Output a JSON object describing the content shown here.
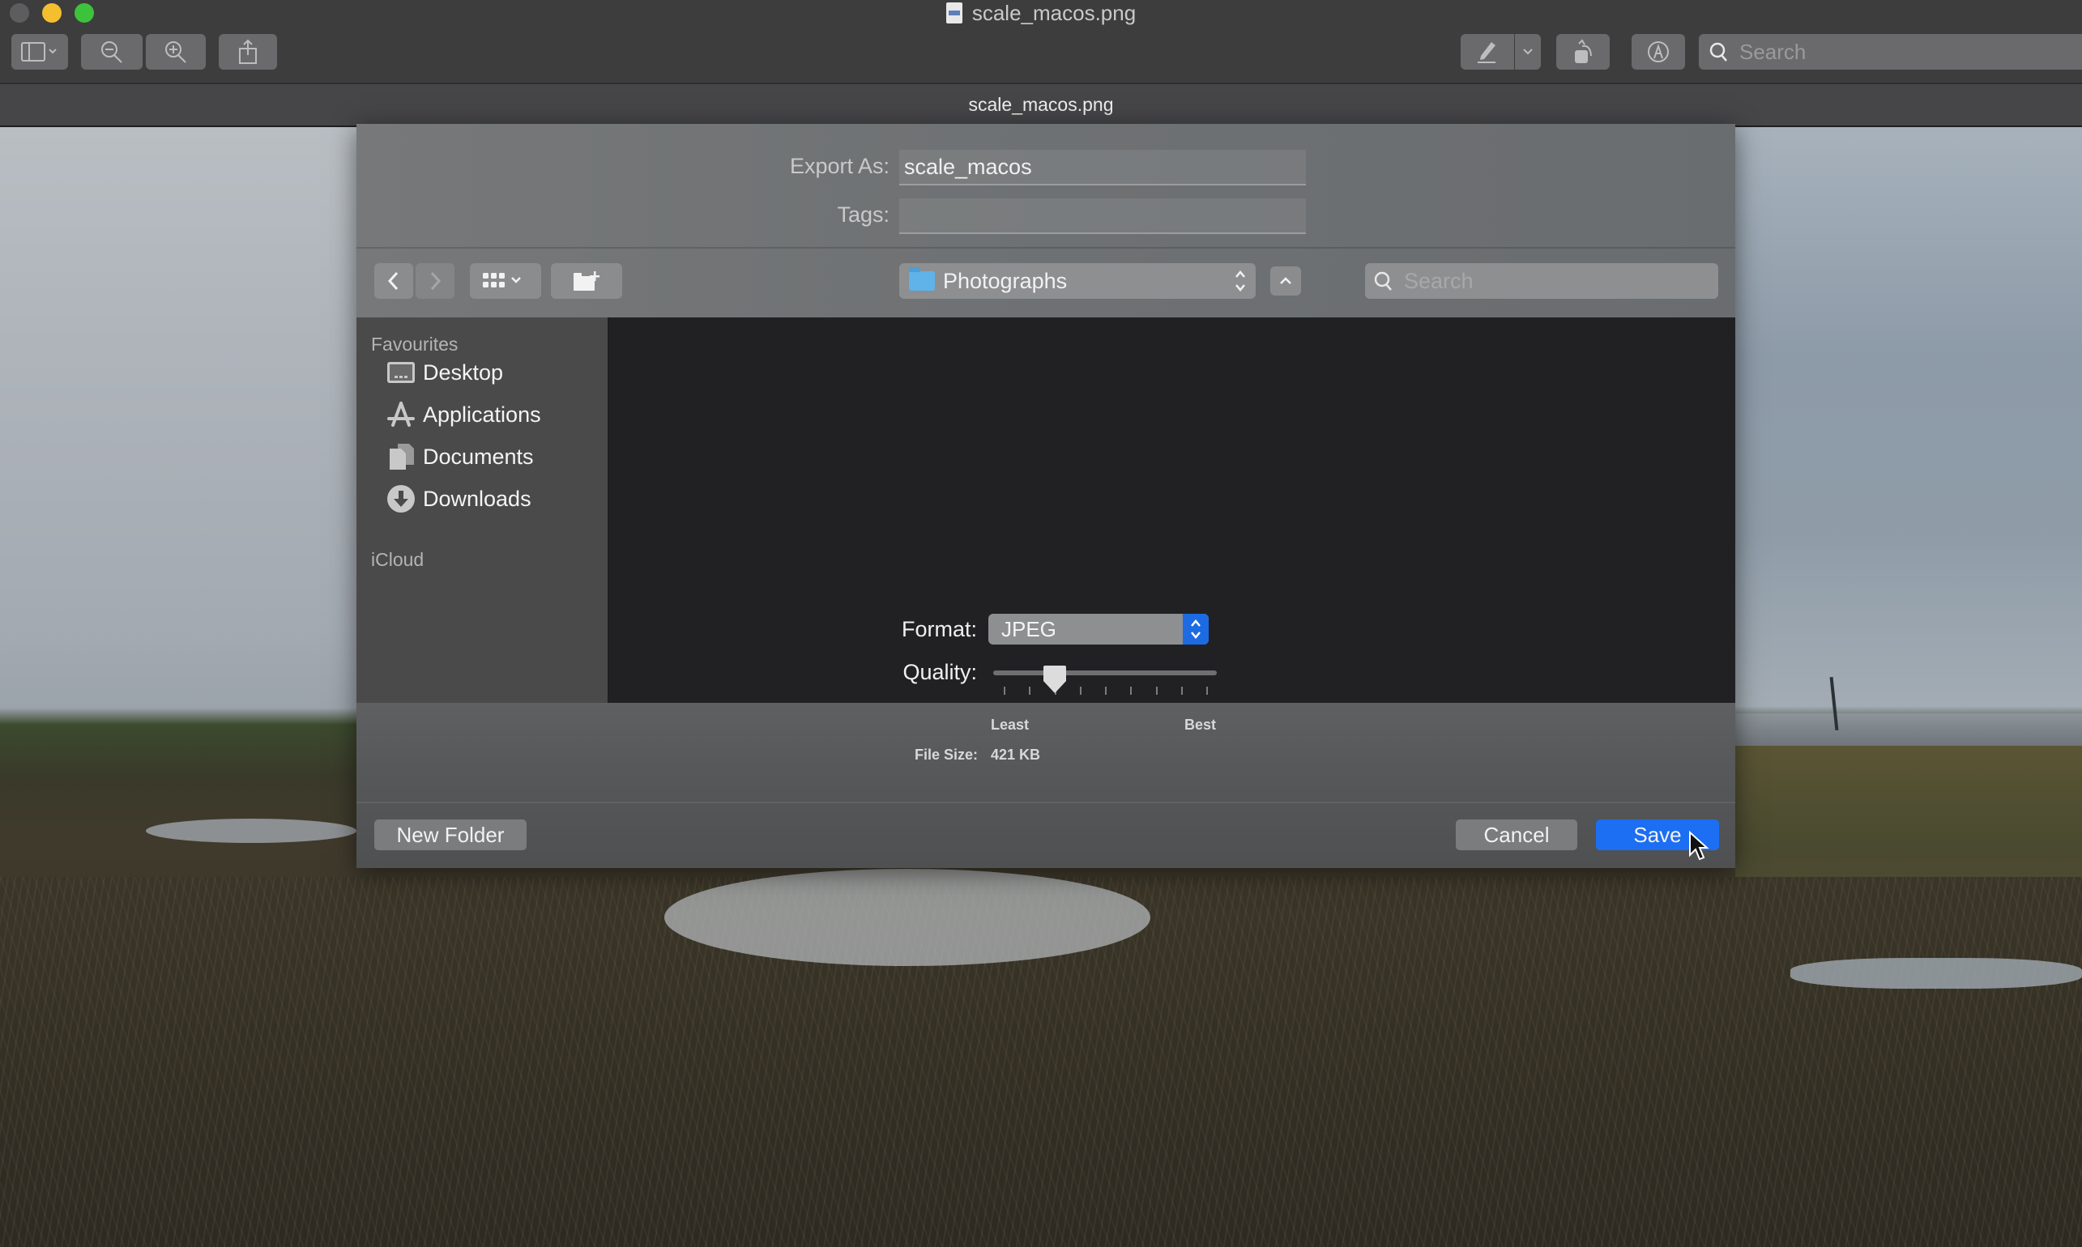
{
  "window": {
    "title": "scale_macos.png",
    "tab_title": "scale_macos.png",
    "traffic_lights": {
      "close": "#5d5d5f",
      "minimize": "#f4bf2f",
      "maximize": "#3dc23c"
    },
    "toolbar": {
      "sidebar_button": "sidebar-toggle-icon",
      "zoom_out": "zoom-out-icon",
      "zoom_in": "zoom-in-icon",
      "share": "share-icon",
      "markup": "pen-icon",
      "rotate": "rotate-icon",
      "annotate": "markup-circle-icon",
      "search_placeholder": "Search"
    }
  },
  "dialog": {
    "export_as_label": "Export As:",
    "export_as_value": "scale_macos",
    "tags_label": "Tags:",
    "tags_value": "",
    "location": "Photographs",
    "search_placeholder": "Search",
    "sidebar": {
      "sections": [
        {
          "title": "Favourites",
          "items": [
            {
              "label": "Desktop",
              "icon": "desktop-icon"
            },
            {
              "label": "Applications",
              "icon": "applications-icon"
            },
            {
              "label": "Documents",
              "icon": "documents-icon"
            },
            {
              "label": "Downloads",
              "icon": "downloads-icon"
            }
          ]
        },
        {
          "title": "iCloud",
          "items": []
        }
      ]
    },
    "format_label": "Format:",
    "format_value": "JPEG",
    "quality_label": "Quality:",
    "quality_min_label": "Least",
    "quality_max_label": "Best",
    "quality_value_fraction": 0.25,
    "quality_ticks": 9,
    "file_size_label": "File Size:",
    "file_size_value": "421 KB",
    "new_folder_label": "New Folder",
    "cancel_label": "Cancel",
    "save_label": "Save",
    "accent_color": "#1c6ef2"
  }
}
